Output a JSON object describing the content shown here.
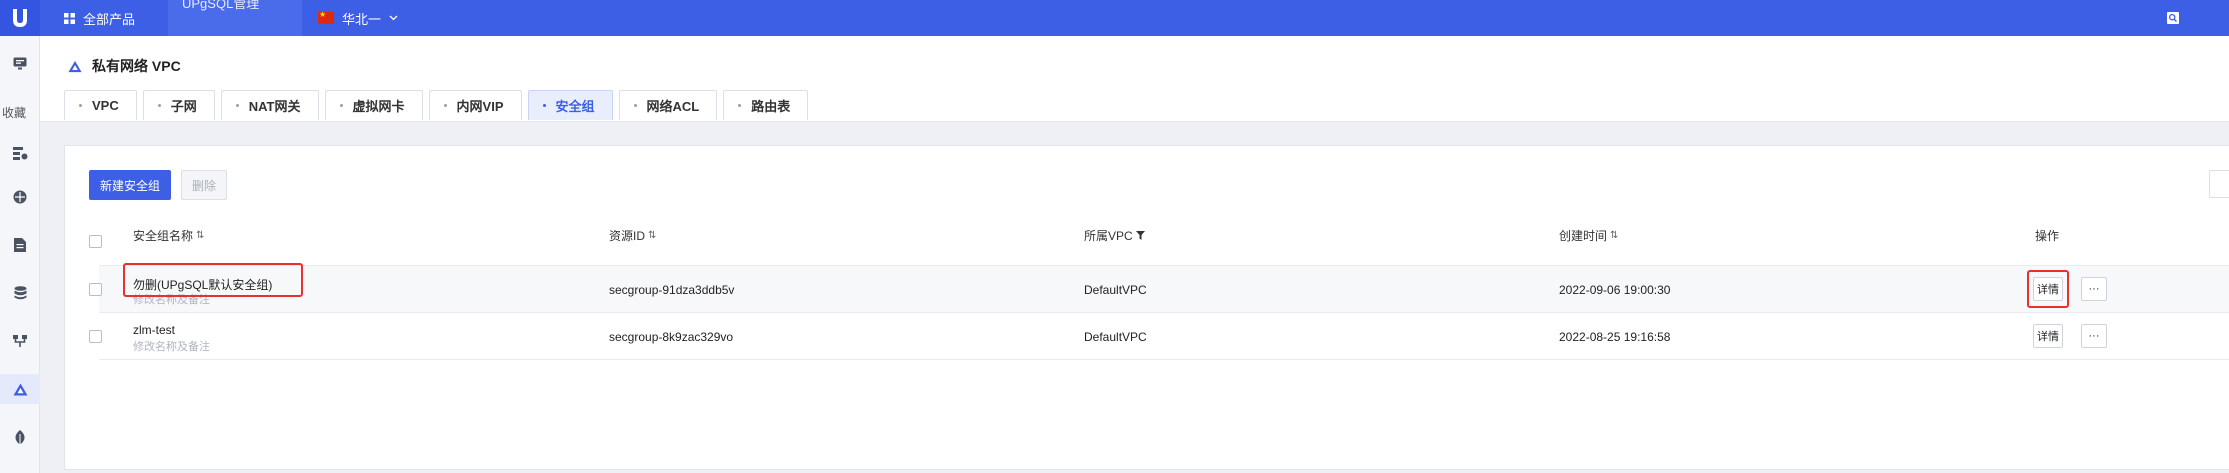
{
  "topbar": {
    "all_products": "全部产品",
    "product_tab": "UPgSQL管理",
    "region": "华北一"
  },
  "sidebar": {
    "fav_label": "收藏",
    "items": [
      {
        "icon": "monitor-icon"
      },
      {
        "icon": "server-list-icon"
      },
      {
        "icon": "globe-icon"
      },
      {
        "icon": "document-icon"
      },
      {
        "icon": "database-icon"
      },
      {
        "icon": "branch-icon"
      },
      {
        "icon": "vpc-icon",
        "active": true
      },
      {
        "icon": "leaf-icon"
      }
    ]
  },
  "page": {
    "title": "私有网络 VPC",
    "tabs": [
      {
        "label": "VPC",
        "active": false
      },
      {
        "label": "子网",
        "active": false
      },
      {
        "label": "NAT网关",
        "active": false
      },
      {
        "label": "虚拟网卡",
        "active": false
      },
      {
        "label": "内网VIP",
        "active": false
      },
      {
        "label": "安全组",
        "active": true
      },
      {
        "label": "网络ACL",
        "active": false
      },
      {
        "label": "路由表",
        "active": false
      }
    ]
  },
  "toolbar": {
    "create_label": "新建安全组",
    "delete_label": "删除"
  },
  "table": {
    "headers": {
      "name": "安全组名称",
      "resource_id": "资源ID",
      "vpc": "所属VPC",
      "created": "创建时间",
      "actions": "操作"
    },
    "rows": [
      {
        "name": "勿删(UPgSQL默认安全组)",
        "note": "修改名称及备注",
        "resource_id": "secgroup-91dza3ddb5v",
        "vpc": "DefaultVPC",
        "created": "2022-09-06 19:00:30",
        "detail_label": "详情",
        "more_label": "···"
      },
      {
        "name": "zlm-test",
        "note": "修改名称及备注",
        "resource_id": "secgroup-8k9zac329vo",
        "vpc": "DefaultVPC",
        "created": "2022-08-25 19:16:58",
        "detail_label": "详情",
        "more_label": "···"
      }
    ]
  },
  "colors": {
    "accent": "#3d5fe6",
    "highlight": "#e8302f"
  }
}
